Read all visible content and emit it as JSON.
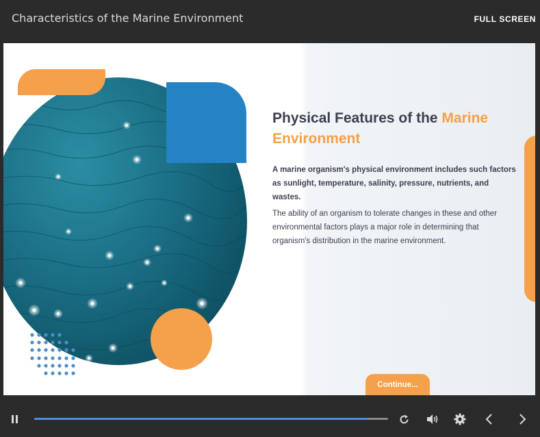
{
  "header": {
    "course_title": "Characteristics of the Marine Environment",
    "fullscreen_label": "FULL SCREEN"
  },
  "slide": {
    "heading_part1": "Physical Features of the ",
    "heading_accent": "Marine Environment",
    "bold_paragraph": "A marine organism's physical environment includes such factors as sunlight, temperature, salinity, pressure, nutrients, and wastes.",
    "paragraph": "The ability of an organism to tolerate changes in these and other environmental factors plays a major role in determining that organism's distribution in the marine environment.",
    "continue_label": "Continue...",
    "image_icon": "ocean-water-image"
  },
  "player": {
    "progress_fraction": 0.94,
    "icons": [
      "pause-icon",
      "replay-icon",
      "volume-icon",
      "gear-icon",
      "chevron-left-icon",
      "chevron-right-icon"
    ]
  },
  "colors": {
    "accent_orange": "#f5a04a",
    "accent_blue": "#2582c5",
    "progress_blue": "#4e8fd9",
    "chrome_dark": "#2b2b2b",
    "heading_dark": "#3c3f4f"
  }
}
